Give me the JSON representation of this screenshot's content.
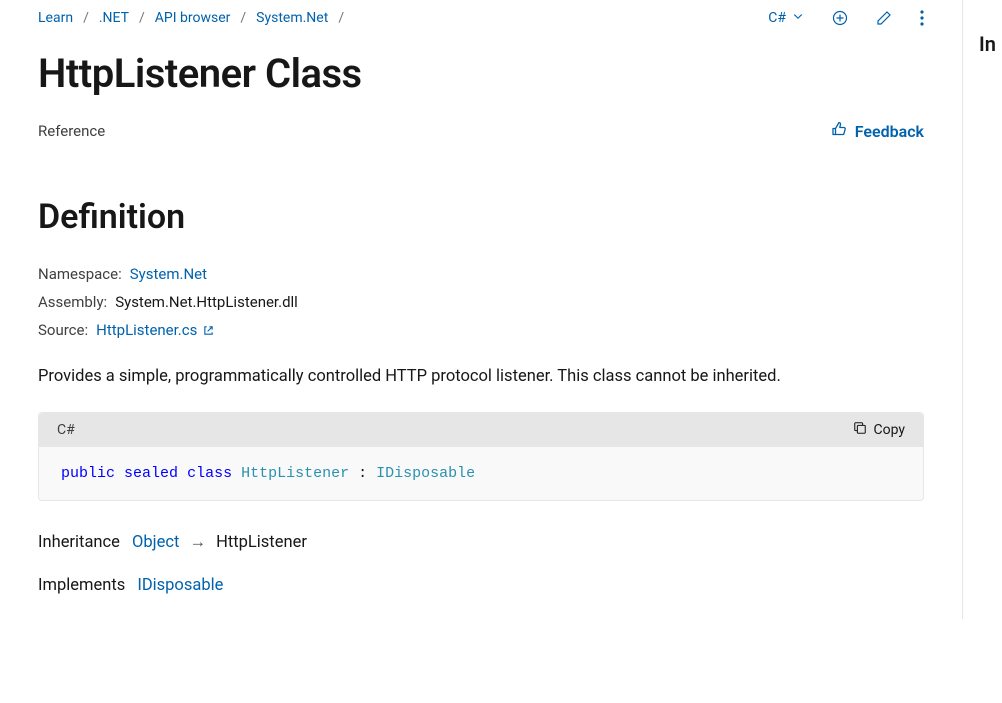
{
  "breadcrumb": {
    "items": [
      "Learn",
      ".NET",
      "API browser",
      "System.Net"
    ]
  },
  "actions": {
    "language": "C#"
  },
  "side_label": "In",
  "title": "HttpListener Class",
  "ref_label": "Reference",
  "feedback_label": "Feedback",
  "definition": {
    "heading": "Definition",
    "namespace_label": "Namespace:",
    "namespace_value": "System.Net",
    "assembly_label": "Assembly:",
    "assembly_value": "System.Net.HttpListener.dll",
    "source_label": "Source:",
    "source_value": "HttpListener.cs"
  },
  "description": "Provides a simple, programmatically controlled HTTP protocol listener. This class cannot be inherited.",
  "code": {
    "language_label": "C#",
    "copy_label": "Copy",
    "tokens": {
      "kw1": "public",
      "kw2": "sealed",
      "kw3": "class",
      "type1": "HttpListener",
      "colon": " : ",
      "type2": "IDisposable"
    }
  },
  "inheritance": {
    "label": "Inheritance",
    "base": "Object",
    "self": "HttpListener"
  },
  "implements": {
    "label": "Implements",
    "iface": "IDisposable"
  }
}
